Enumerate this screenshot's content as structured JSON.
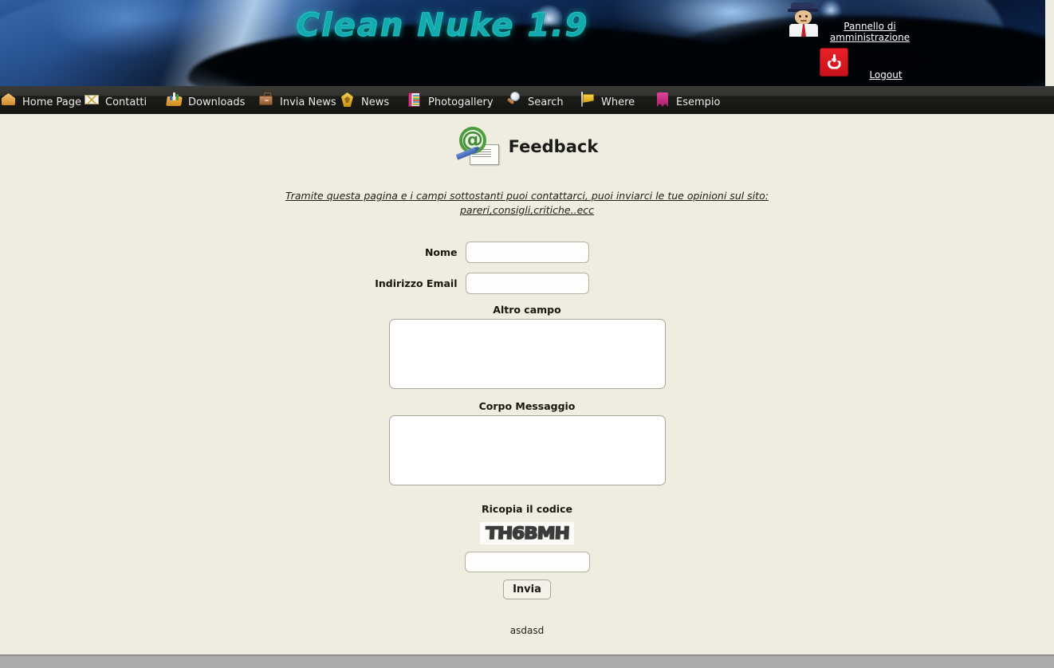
{
  "site": {
    "logo_text": "Clean Nuke 1.9",
    "admin_panel_label": "Pannello di amministrazione",
    "logout_label": "Logout",
    "admin_icon": "admin-character-icon",
    "power_icon": "power-icon"
  },
  "nav": {
    "items": [
      {
        "label": "Home Page",
        "icon": "home-icon"
      },
      {
        "label": "Contatti",
        "icon": "mail-icon"
      },
      {
        "label": "Downloads",
        "icon": "downloads-folder-icon"
      },
      {
        "label": "Invia News",
        "icon": "briefcase-icon"
      },
      {
        "label": "News",
        "icon": "news-badge-icon"
      },
      {
        "label": "Photogallery",
        "icon": "photo-book-icon"
      },
      {
        "label": "Search",
        "icon": "magnifier-icon"
      },
      {
        "label": "Where",
        "icon": "flag-icon"
      },
      {
        "label": "Esempio",
        "icon": "bookmark-icon"
      }
    ]
  },
  "page": {
    "title": "Feedback",
    "title_icon": "at-envelope-icon",
    "intro": "Tramite questa pagina e i campi sottostanti puoi contattarci, puoi inviarci le tue opinioni sul sito: pareri,consigli,critiche..ecc",
    "footer_note": "asdasd"
  },
  "form": {
    "nome": {
      "label": "Nome",
      "value": "",
      "placeholder": ""
    },
    "email": {
      "label": "Indirizzo Email",
      "value": "",
      "placeholder": ""
    },
    "altro": {
      "label": "Altro campo",
      "value": "",
      "placeholder": ""
    },
    "corpo": {
      "label": "Corpo Messaggio",
      "value": "",
      "placeholder": ""
    },
    "captcha": {
      "label": "Ricopia il codice",
      "code": "TH6BMH",
      "value": "",
      "placeholder": ""
    },
    "submit_label": "Invia"
  },
  "colors": {
    "page_background": "#efece0",
    "navbar": "#1c1c19",
    "banner_blue": "#12305f",
    "logo_teal": "#1ad9d9",
    "power_red": "#c9121b",
    "input_border": "#b3b09e",
    "bottom_bar": "#ababab"
  }
}
